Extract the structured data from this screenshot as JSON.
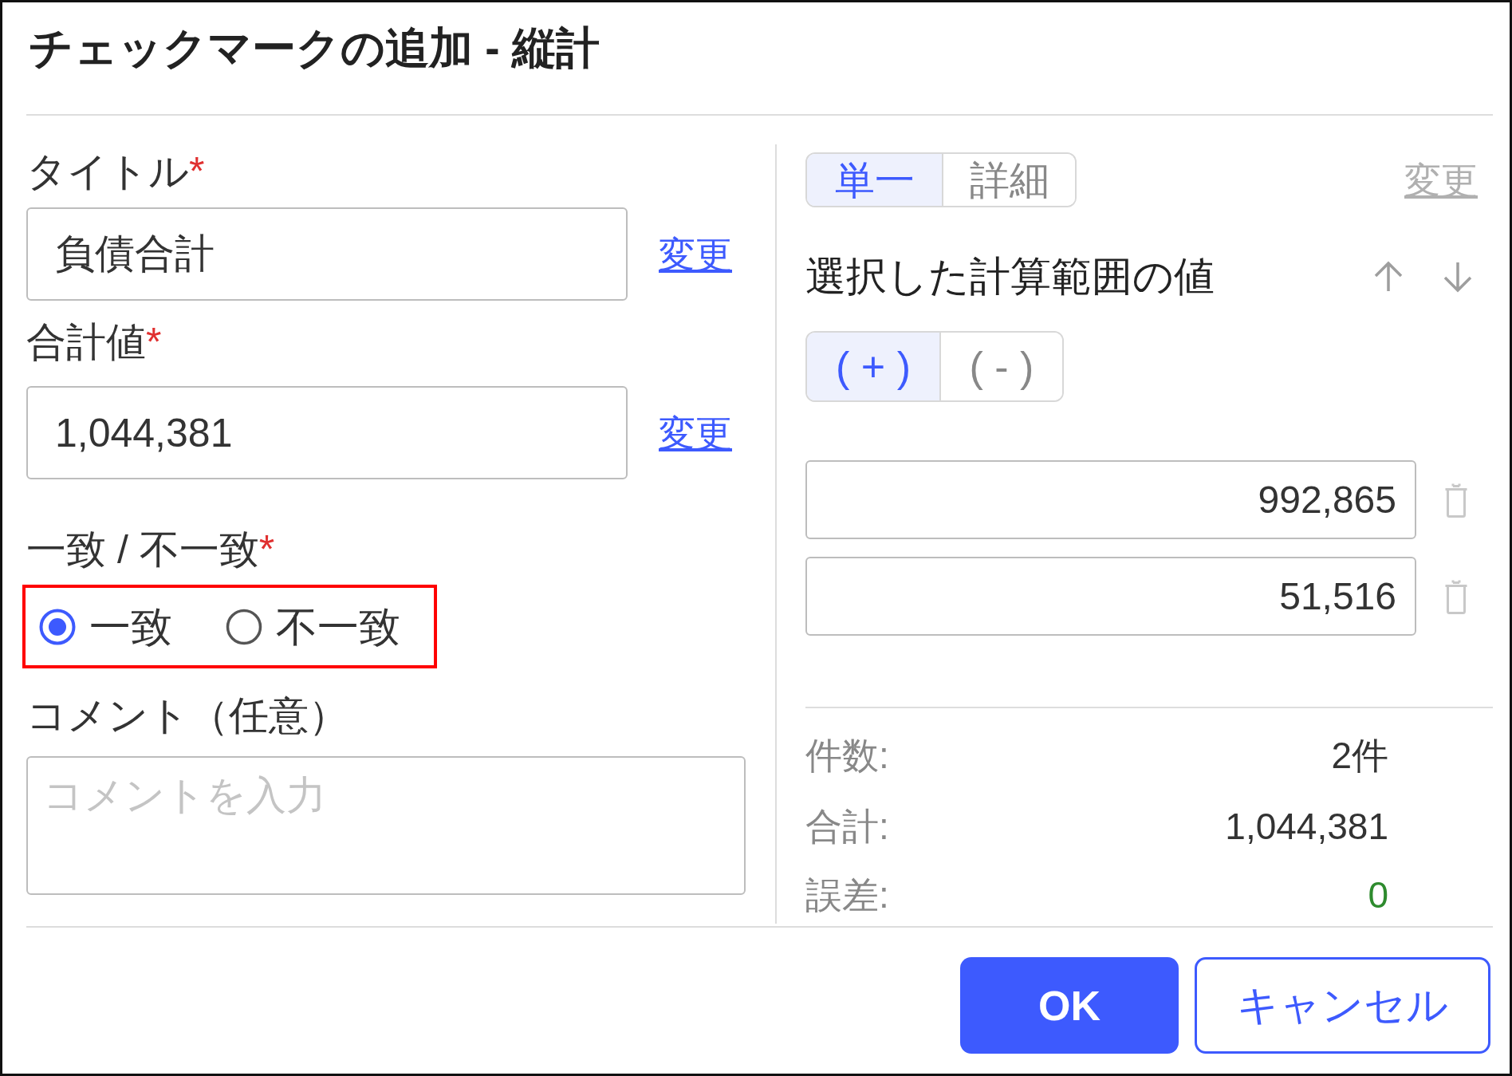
{
  "dialog": {
    "title": "チェックマークの追加 - 縦計"
  },
  "form": {
    "title_field": {
      "label": "タイトル",
      "required_mark": "*",
      "value": "負債合計",
      "link": "変更"
    },
    "total_field": {
      "label": "合計値",
      "required_mark": "*",
      "value": "1,044,381",
      "link": "変更"
    },
    "match": {
      "label": "一致 / 不一致",
      "required_mark": "*",
      "highlighted": true,
      "options": [
        {
          "label": "一致",
          "selected": true
        },
        {
          "label": "不一致",
          "selected": false
        }
      ]
    },
    "comment": {
      "label": "コメント（任意）",
      "placeholder": "コメントを入力"
    }
  },
  "range_panel": {
    "mode_tabs": [
      {
        "label": "単一",
        "selected": true
      },
      {
        "label": "詳細",
        "selected": false
      }
    ],
    "change_link": {
      "label": "変更",
      "disabled": true
    },
    "heading": "選択した計算範囲の値",
    "sign_tabs": [
      {
        "label": "( + )",
        "selected": true
      },
      {
        "label": "( - )",
        "selected": false
      }
    ],
    "values": [
      "992,865",
      "51,516"
    ],
    "summary": [
      {
        "label": "件数:",
        "value": "2件",
        "color": "#333333"
      },
      {
        "label": "合計:",
        "value": "1,044,381",
        "color": "#333333"
      },
      {
        "label": "誤差:",
        "value": "0",
        "color": "#2e8b2e"
      }
    ]
  },
  "buttons": [
    {
      "label": "OK",
      "kind": "primary"
    },
    {
      "label": "キャンセル",
      "kind": "secondary"
    }
  ]
}
